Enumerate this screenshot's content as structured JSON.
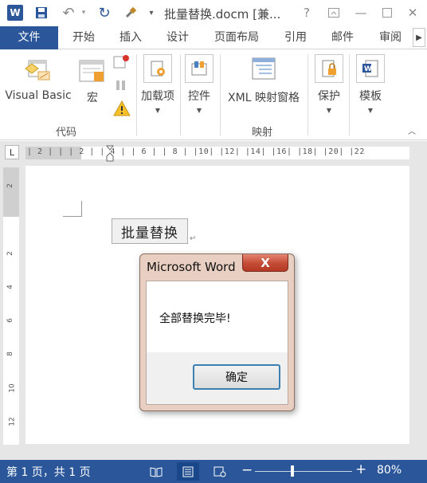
{
  "titlebar": {
    "title": "批量替换.docm [兼...",
    "help": "?",
    "app_logo": "W",
    "icons": {
      "save": "save-icon",
      "undo": "undo-icon",
      "redo": "redo-icon",
      "format_painter": "format-painter-icon"
    }
  },
  "tabs": {
    "file": "文件",
    "items": [
      "开始",
      "插入",
      "设计",
      "页面布局",
      "引用",
      "邮件",
      "审阅"
    ]
  },
  "ribbon": {
    "visual_basic": "Visual Basic",
    "macro": "宏",
    "addins": "加载项",
    "controls": "控件",
    "xml_mapping": "XML 映射窗格",
    "protect": "保护",
    "template": "模板",
    "group_code": "代码",
    "group_mapping": "映射"
  },
  "ruler": {
    "corner": "L",
    "horizontal": "| 2 |   |   | 2 |   | 4 |   | 6 |   | 8 |   |10|   |12|   |14|   |16|   |18|   |20|   |22",
    "vertical": [
      "2",
      "2",
      "4",
      "6",
      "8",
      "10",
      "12"
    ]
  },
  "document": {
    "button_label": "批量替换",
    "para_mark": "↵"
  },
  "dialog": {
    "title": "Microsoft Word",
    "close": "X",
    "message": "全部替换完毕!",
    "ok_label": "确定"
  },
  "statusbar": {
    "page_info": "第 1 页，共 1 页",
    "zoom": "80%",
    "zoom_level_percent": 80
  },
  "colors": {
    "brand": "#2b579a",
    "dialog_frame": "#e8cfc2",
    "close_button": "#c44b36"
  }
}
